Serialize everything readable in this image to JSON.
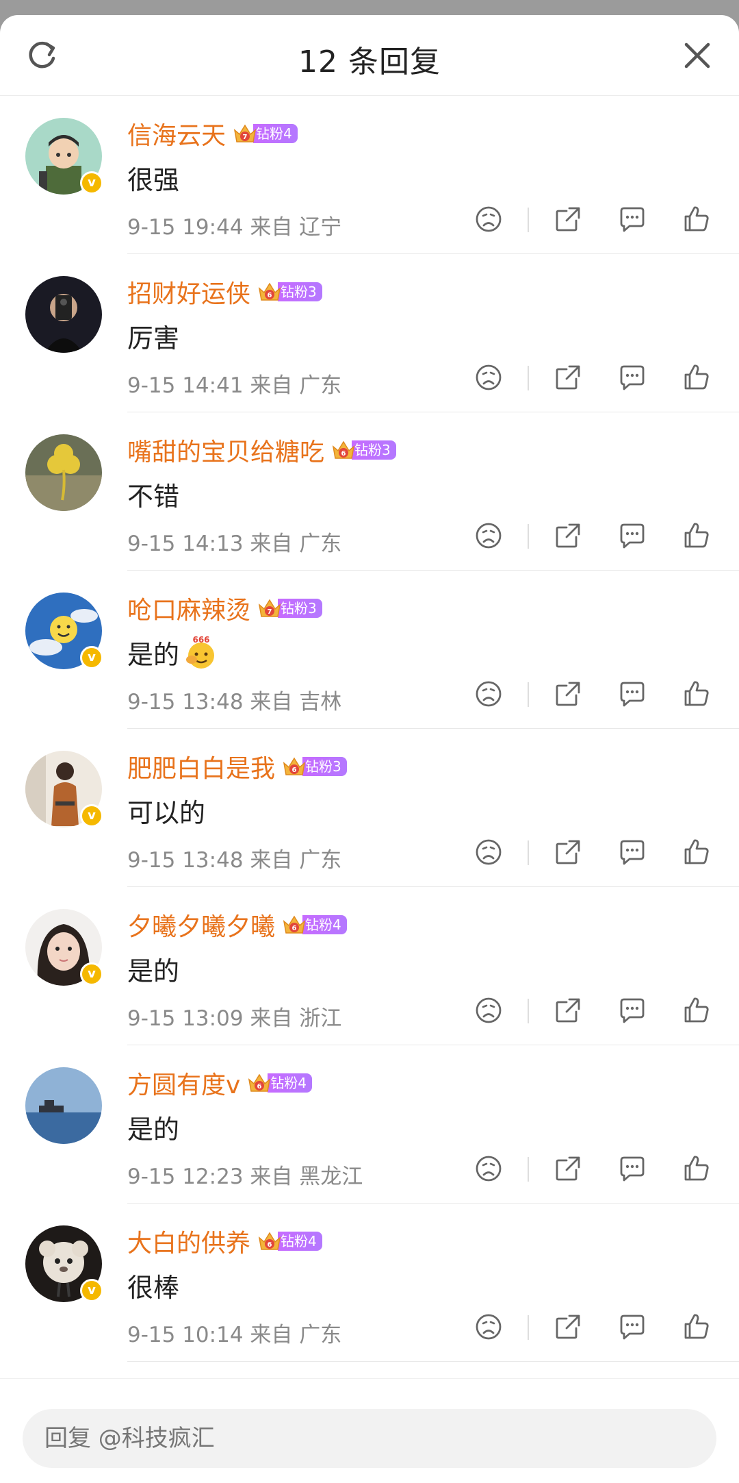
{
  "header": {
    "title": "12 条回复",
    "refresh_icon": "refresh-icon",
    "close_icon": "close-icon"
  },
  "colors": {
    "name": "#e8731c",
    "fan_badge": "#b478ff",
    "verified": "#f5b800",
    "meta": "#8a8a8a"
  },
  "comments": [
    {
      "name": "信海云天",
      "fan_level": "钻粉4",
      "crown_num": "7",
      "text": "很强",
      "time": "9-15 19:44",
      "source": "来自 辽宁",
      "verified": true,
      "avatar": "cartoon-soldier"
    },
    {
      "name": "招财好运侠",
      "fan_level": "钻粉3",
      "crown_num": "6",
      "text": "厉害",
      "time": "9-15 14:41",
      "source": "来自 广东",
      "verified": false,
      "avatar": "phone-selfie"
    },
    {
      "name": "嘴甜的宝贝给糖吃",
      "fan_level": "钻粉3",
      "crown_num": "6",
      "text": "不错",
      "time": "9-15 14:13",
      "source": "来自 广东",
      "verified": false,
      "avatar": "clover"
    },
    {
      "name": "呛口麻辣烫",
      "fan_level": "钻粉3",
      "crown_num": "7",
      "text": "是的",
      "time": "9-15 13:48",
      "source": "来自 吉林",
      "verified": true,
      "avatar": "sun-sky",
      "emoji": "666-emoji"
    },
    {
      "name": "肥肥白白是我",
      "fan_level": "钻粉3",
      "crown_num": "6",
      "text": "可以的",
      "time": "9-15 13:48",
      "source": "来自 广东",
      "verified": true,
      "avatar": "girl-coat"
    },
    {
      "name": "夕曦夕曦夕曦",
      "fan_level": "钻粉4",
      "crown_num": "6",
      "text": "是的",
      "time": "9-15 13:09",
      "source": "来自 浙江",
      "verified": true,
      "avatar": "little-girl"
    },
    {
      "name": "方圆有度v",
      "fan_level": "钻粉4",
      "crown_num": "6",
      "text": "是的",
      "time": "9-15 12:23",
      "source": "来自 黑龙江",
      "verified": false,
      "avatar": "sea-ship"
    },
    {
      "name": "大白的供养",
      "fan_level": "钻粉4",
      "crown_num": "6",
      "text": "很棒",
      "time": "9-15 10:14",
      "source": "来自 广东",
      "verified": true,
      "avatar": "plush-toy"
    }
  ],
  "footer": {
    "reply_placeholder": "回复 @科技疯汇"
  }
}
